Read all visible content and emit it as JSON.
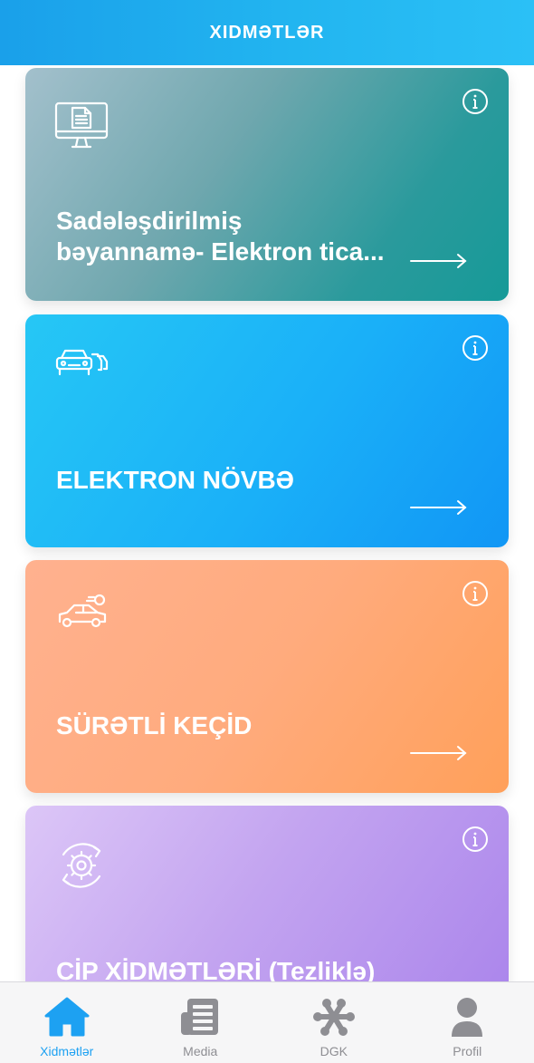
{
  "header": {
    "title": "XIDMƏTLƏR"
  },
  "cards": [
    {
      "title": "Sadələşdirilmiş\nbəyannamə- Elektron tica...",
      "icon": "monitor-document-icon"
    },
    {
      "title": "ELEKTRON NÖVBƏ",
      "icon": "car-queue-icon"
    },
    {
      "title": "SÜRƏTLİ KEÇİD",
      "icon": "fast-car-icon"
    },
    {
      "title": "CİP XİDMƏTLƏRİ (Tezliklə)",
      "icon": "gear-cycle-icon"
    }
  ],
  "tabs": [
    {
      "label": "Xidmətlər",
      "icon": "home-icon",
      "active": true
    },
    {
      "label": "Media",
      "icon": "newspaper-icon",
      "active": false
    },
    {
      "label": "DGK",
      "icon": "dgk-logo-icon",
      "active": false
    },
    {
      "label": "Profil",
      "icon": "user-icon",
      "active": false
    }
  ],
  "colors": {
    "header": "#22b5f0",
    "active_tab": "#1da1f2",
    "inactive_tab": "#8e8e93",
    "card_1": "#169a98",
    "card_2": "#1196f5",
    "card_3": "#ffa05a",
    "card_4": "#a983eb"
  }
}
